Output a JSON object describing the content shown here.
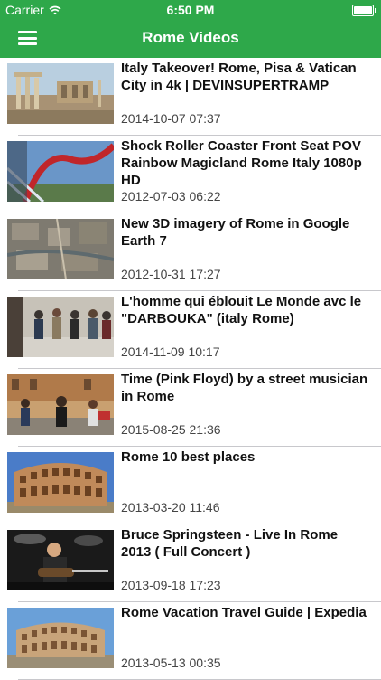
{
  "status_bar": {
    "carrier": "Carrier",
    "time": "6:50 PM"
  },
  "nav": {
    "title": "Rome Videos",
    "menu_icon": "hamburger-menu-icon"
  },
  "videos": [
    {
      "title": "Italy Takeover! Rome, Pisa & Vatican City in 4k | DEVINSUPERTRAMP",
      "date": "2014-10-07 07:37",
      "thumb": "roman-forum"
    },
    {
      "title": "Shock Roller Coaster Front Seat POV Rainbow Magicland Rome Italy 1080p HD",
      "date": "2012-07-03 06:22",
      "thumb": "roller-coaster"
    },
    {
      "title": "New 3D imagery of Rome in Google Earth 7",
      "date": "2012-10-31 17:27",
      "thumb": "aerial-rome"
    },
    {
      "title": "L'homme qui éblouit Le Monde avc le \"DARBOUKA\" (italy Rome)",
      "date": "2014-11-09 10:17",
      "thumb": "street-crowd"
    },
    {
      "title": "Time (Pink Floyd) by a street musician in Rome",
      "date": "2015-08-25 21:36",
      "thumb": "street-musician"
    },
    {
      "title": "Rome 10 best places",
      "date": "2013-03-20 11:46",
      "thumb": "colosseum"
    },
    {
      "title": "Bruce Springsteen - Live In Rome 2013 ( Full Concert )",
      "date": "2013-09-18 17:23",
      "thumb": "concert"
    },
    {
      "title": "Rome Vacation Travel Guide | Expedia",
      "date": "2013-05-13 00:35",
      "thumb": "colosseum-expedia"
    }
  ],
  "colors": {
    "nav_green": "#2ea84a",
    "separator": "#c8c8cc"
  }
}
